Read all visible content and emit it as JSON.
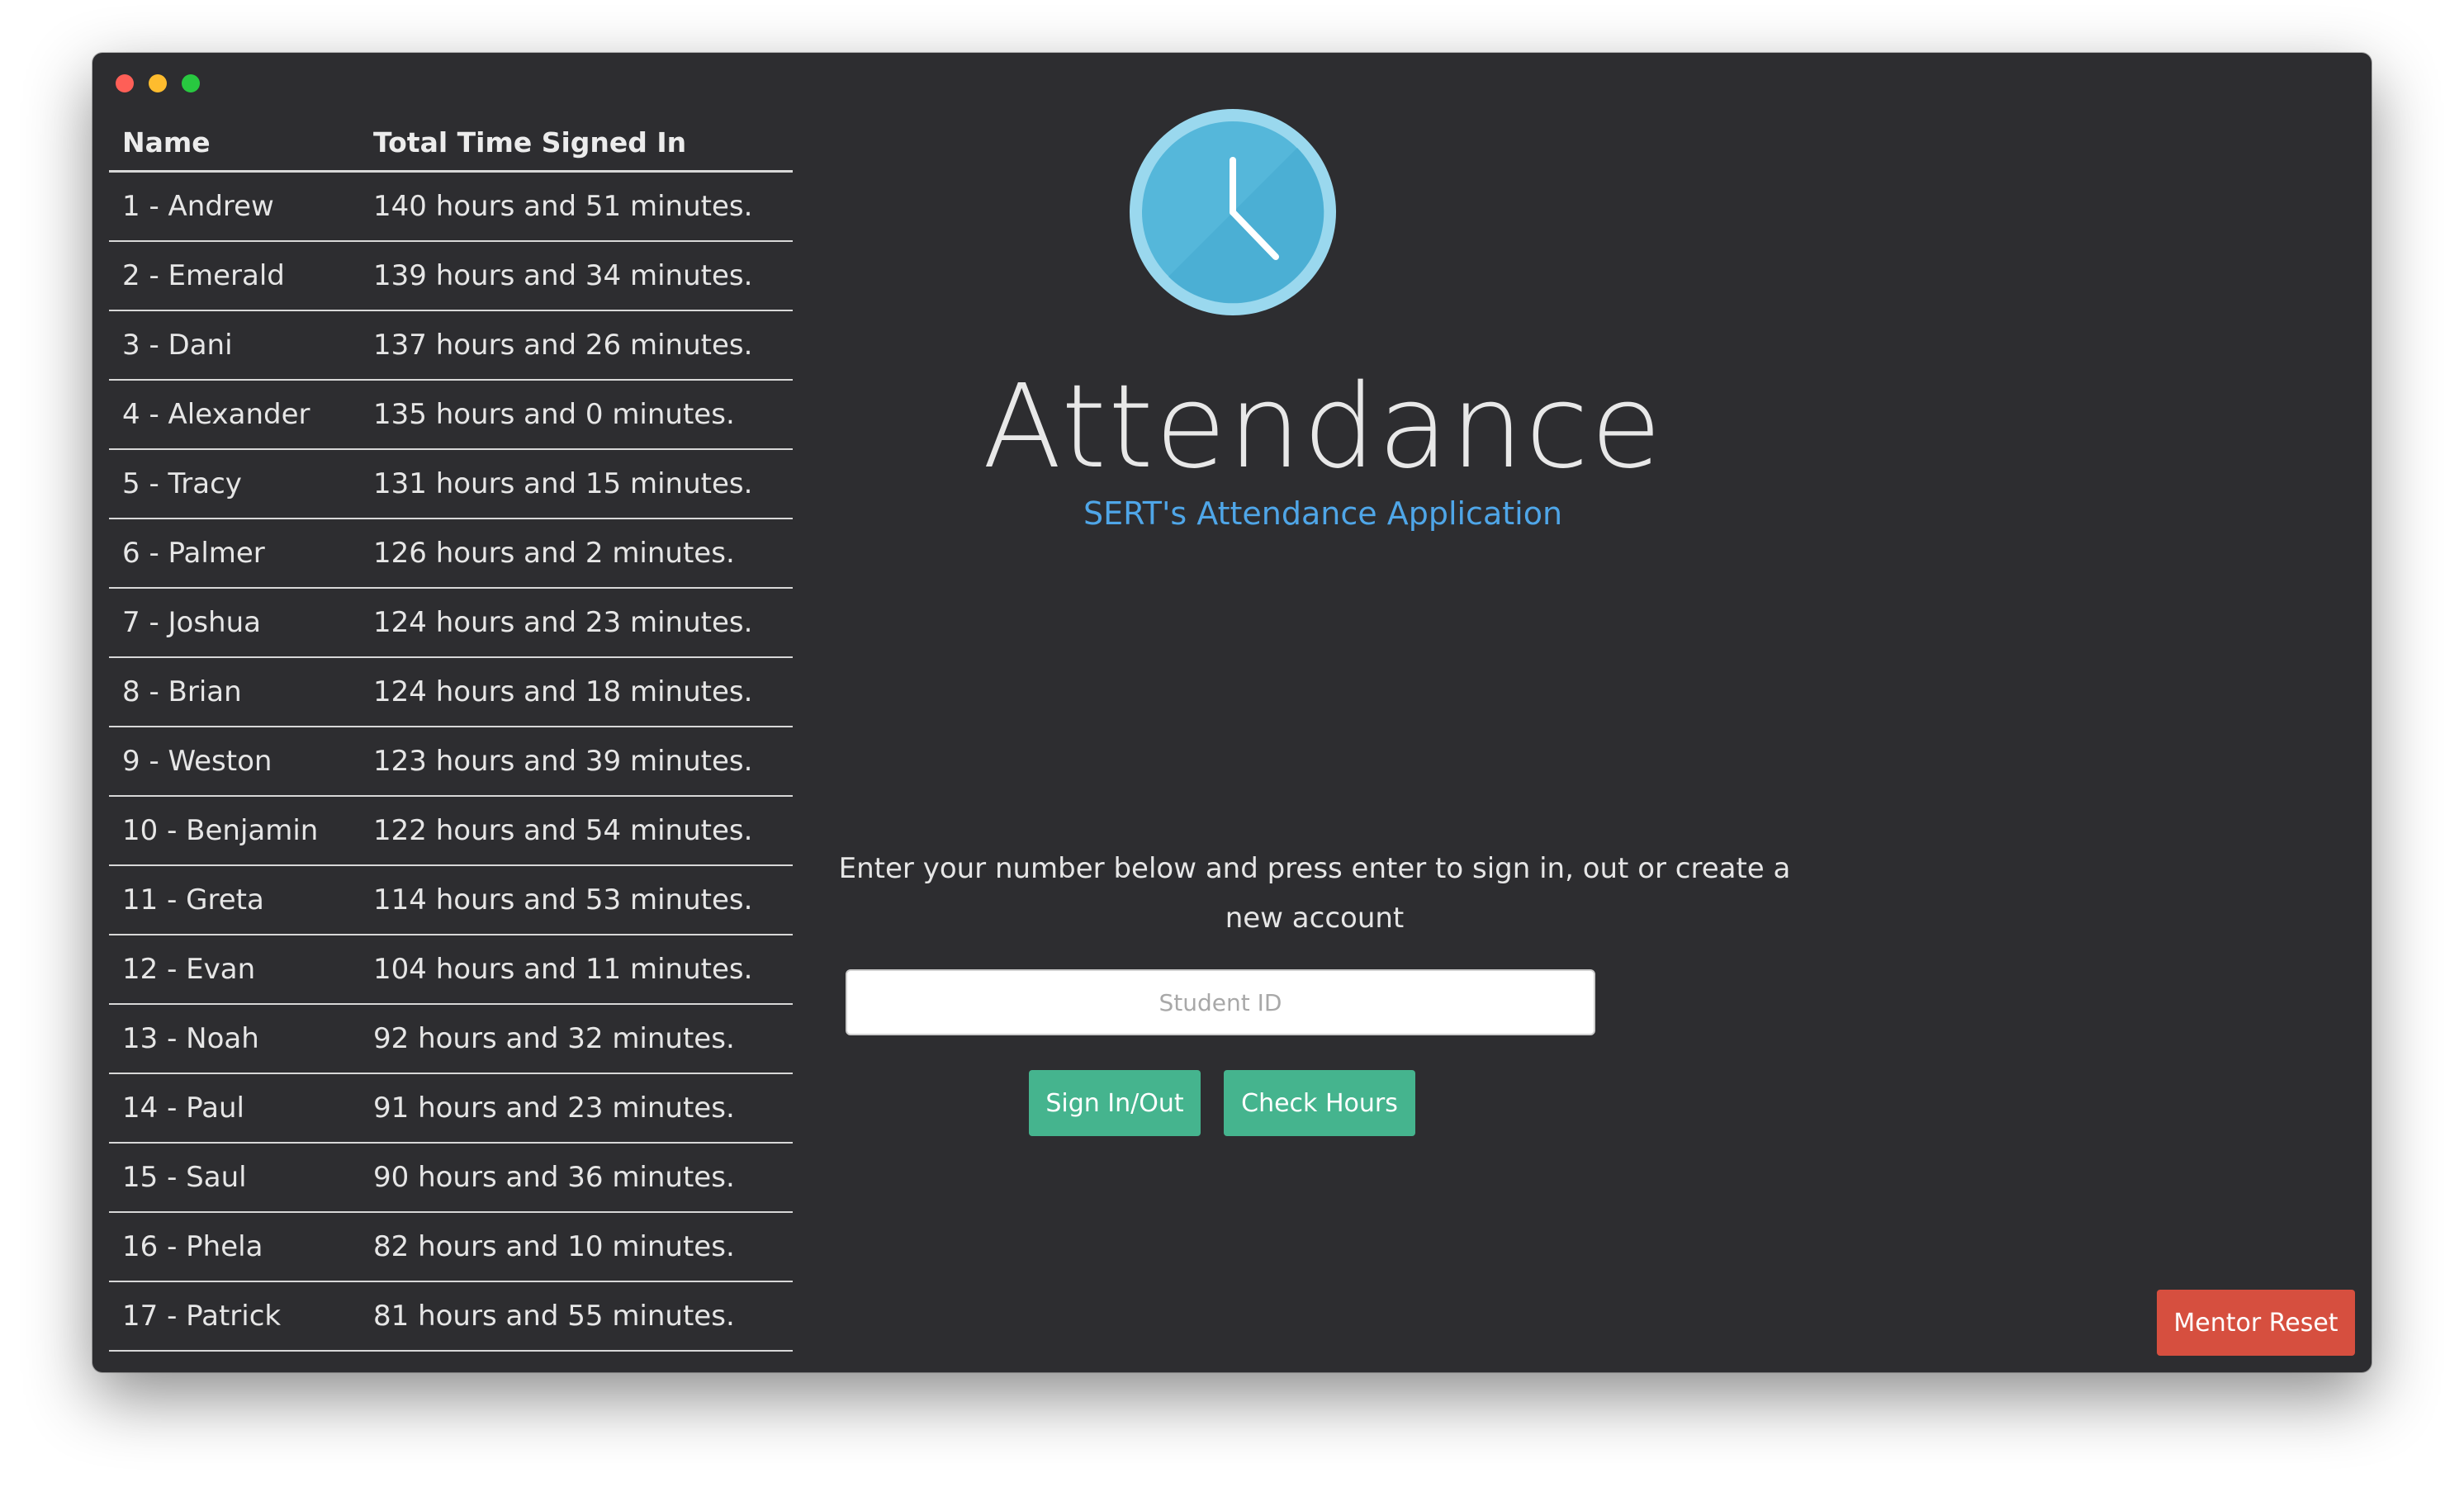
{
  "window": {
    "controls": [
      "close",
      "minimize",
      "zoom"
    ]
  },
  "table": {
    "headers": {
      "name": "Name",
      "time": "Total Time Signed In"
    },
    "rows": [
      {
        "name": "1 - Andrew",
        "time": "140 hours and 51 minutes."
      },
      {
        "name": "2 - Emerald",
        "time": "139 hours and 34 minutes."
      },
      {
        "name": "3 - Dani",
        "time": "137 hours and 26 minutes."
      },
      {
        "name": "4 - Alexander",
        "time": "135 hours and 0 minutes."
      },
      {
        "name": "5 - Tracy",
        "time": "131 hours and 15 minutes."
      },
      {
        "name": "6 - Palmer",
        "time": "126 hours and 2 minutes."
      },
      {
        "name": "7 - Joshua",
        "time": "124 hours and 23 minutes."
      },
      {
        "name": "8 - Brian",
        "time": "124 hours and 18 minutes."
      },
      {
        "name": "9 - Weston",
        "time": "123 hours and 39 minutes."
      },
      {
        "name": "10 - Benjamin",
        "time": "122 hours and 54 minutes."
      },
      {
        "name": "11 - Greta",
        "time": "114 hours and 53 minutes."
      },
      {
        "name": "12 - Evan",
        "time": "104 hours and 11 minutes."
      },
      {
        "name": "13 - Noah",
        "time": "92 hours and 32 minutes."
      },
      {
        "name": "14 - Paul",
        "time": "91 hours and 23 minutes."
      },
      {
        "name": "15 - Saul",
        "time": "90 hours and 36 minutes."
      },
      {
        "name": "16 - Phela",
        "time": "82 hours and 10 minutes."
      },
      {
        "name": "17 - Patrick",
        "time": "81 hours and 55 minutes."
      }
    ]
  },
  "hero": {
    "icon": "clock-icon",
    "title": "Attendance",
    "subtitle": "SERT's Attendance Application"
  },
  "signin": {
    "instructions": "Enter your number below and press enter to sign in, out or create a new account",
    "placeholder": "Student ID",
    "value": "",
    "signin_label": "Sign In/Out",
    "check_label": "Check Hours"
  },
  "mentor": {
    "reset_label": "Mentor Reset"
  },
  "colors": {
    "window_bg": "#2d2d30",
    "accent_blue": "#4fa6e8",
    "clock_blue": "#55b7da",
    "button_green": "#45b48e",
    "button_red": "#d64f3f"
  }
}
